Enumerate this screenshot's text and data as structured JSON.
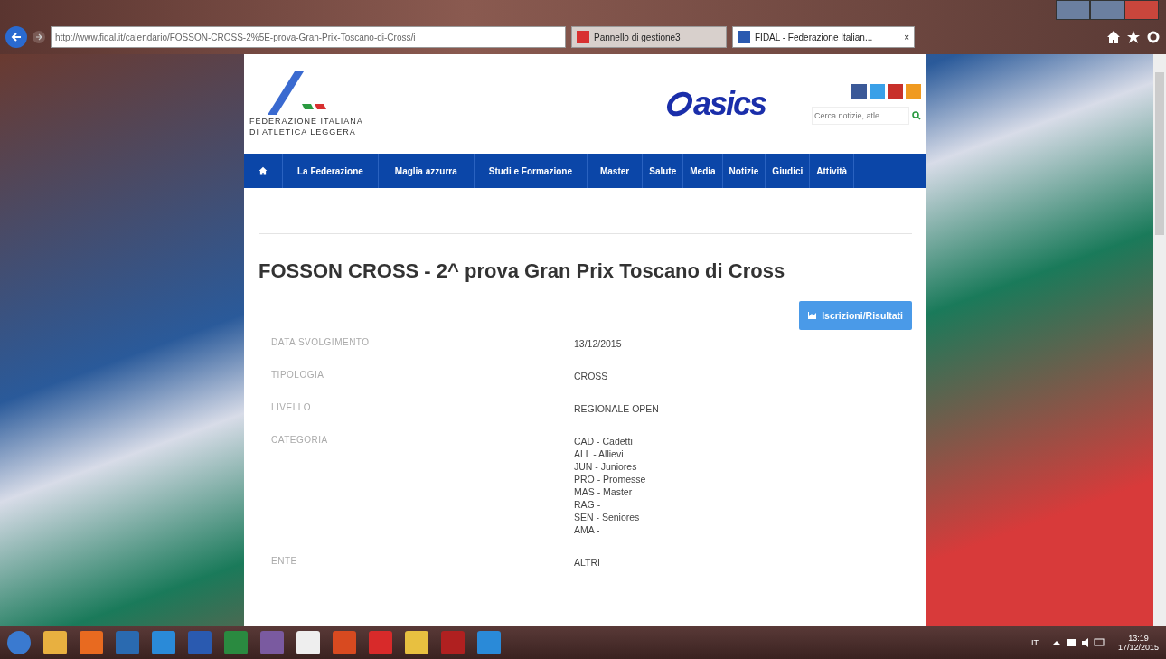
{
  "browser": {
    "address": "http://www.fidal.it/calendario/FOSSON-CROSS-2%5E-prova-Gran-Prix-Toscano-di-Cross/i",
    "tabs": [
      {
        "label": "Pannello di gestione3",
        "selected": false
      },
      {
        "label": "FIDAL - Federazione Italian...",
        "selected": true
      }
    ],
    "close": "×"
  },
  "header": {
    "org_line1": "FEDERAZIONE ITALIANA",
    "org_line2": "DI ATLETICA LEGGERA",
    "sponsor": "asics",
    "search": {
      "placeholder": "Cerca notizie, atle"
    }
  },
  "nav": {
    "items": [
      {
        "label": "La Federazione"
      },
      {
        "label": "Maglia azzurra"
      },
      {
        "label": "Studi e Formazione"
      },
      {
        "label": "Master"
      },
      {
        "label": "Salute"
      },
      {
        "label": "Media"
      },
      {
        "label": "Notizie"
      },
      {
        "label": "Giudici"
      },
      {
        "label": "Attività"
      }
    ]
  },
  "event": {
    "title": "FOSSON CROSS - 2^ prova Gran Prix Toscano di Cross",
    "button": "Iscrizioni/Risultati",
    "details": [
      {
        "label": "DATA SVOLGIMENTO",
        "values": [
          "13/12/2015"
        ]
      },
      {
        "label": "TIPOLOGIA",
        "values": [
          "CROSS"
        ]
      },
      {
        "label": "LIVELLO",
        "values": [
          "REGIONALE OPEN"
        ]
      },
      {
        "label": "CATEGORIA",
        "values": [
          "CAD - Cadetti",
          "ALL - Allievi",
          "JUN - Juniores",
          "PRO - Promesse",
          "MAS - Master",
          "RAG -",
          "SEN - Seniores",
          "AMA -"
        ]
      },
      {
        "label": "ENTE",
        "values": [
          "ALTRI"
        ]
      }
    ]
  },
  "taskbar": {
    "language": "IT",
    "time": "13:19",
    "date": "17/12/2015"
  }
}
